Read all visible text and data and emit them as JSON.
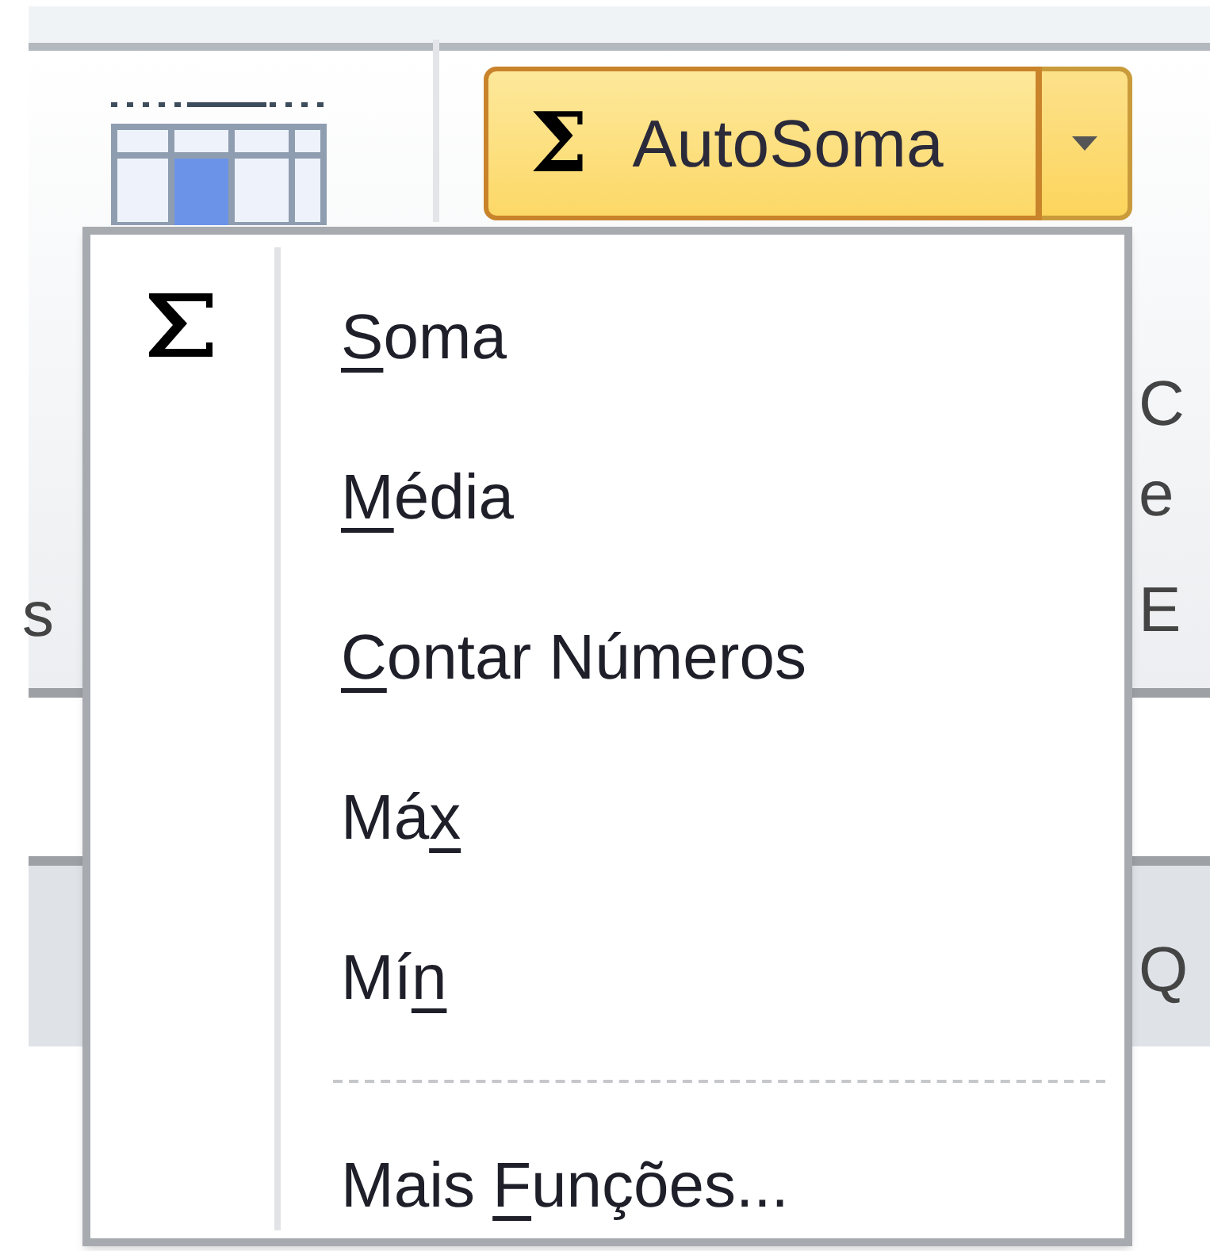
{
  "autosum_button": {
    "label": "AutoSoma",
    "icon_text": "Σ"
  },
  "menu": {
    "items": [
      {
        "kind": "item",
        "checked": true,
        "key": "S",
        "after": "oma"
      },
      {
        "kind": "item",
        "checked": false,
        "key": "M",
        "after": "édia"
      },
      {
        "kind": "item",
        "checked": false,
        "key": "C",
        "after": "ontar Números"
      },
      {
        "kind": "item",
        "checked": false,
        "before": "Má",
        "key": "x"
      },
      {
        "kind": "item",
        "checked": false,
        "before": "Mí",
        "key": "n"
      },
      {
        "kind": "separator"
      },
      {
        "kind": "item",
        "checked": false,
        "before": "Mais ",
        "key": "F",
        "after": "unções..."
      }
    ]
  },
  "background_fragments": {
    "left": [
      "s"
    ],
    "right": [
      "C",
      "e",
      "E",
      "Q"
    ]
  }
}
